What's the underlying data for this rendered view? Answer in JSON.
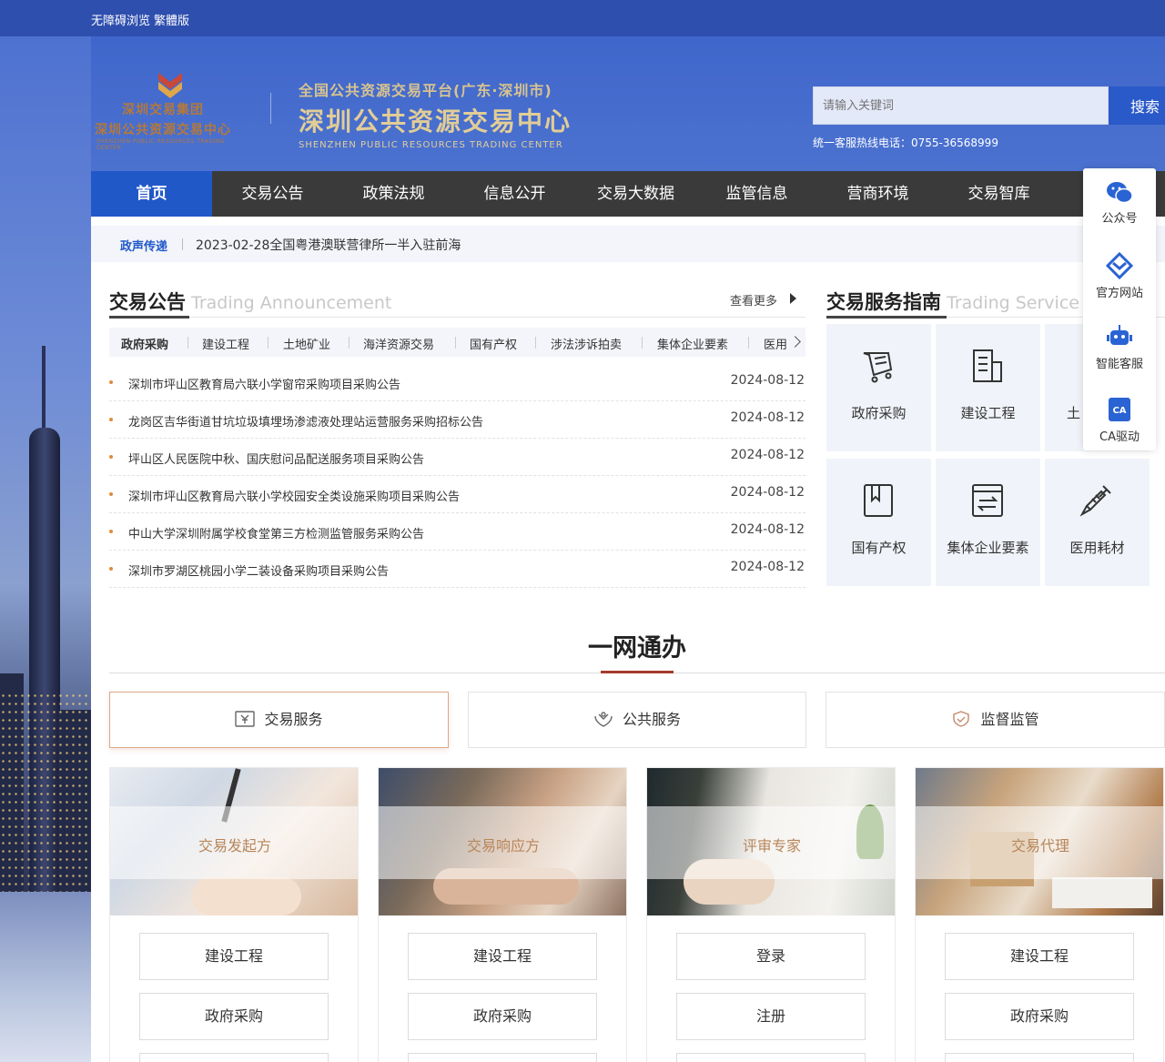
{
  "topbar": {
    "accessible": "无障碍浏览",
    "traditional": "繁體版"
  },
  "logo_group": {
    "line1": "深圳交易集团",
    "line2": "深圳公共资源交易中心",
    "line3": "SHENZHEN PUBLIC RESOURCES TRADING CENTER"
  },
  "logo_main": {
    "platform": "全国公共资源交易平台(广东·深圳市)",
    "name": "深圳公共资源交易中心",
    "english": "SHENZHEN PUBLIC RESOURCES TRADING CENTER"
  },
  "search": {
    "placeholder": "请输入关键词",
    "button": "搜索",
    "hotline": "统一客服热线电话：0755-36568999"
  },
  "nav": [
    "首页",
    "交易公告",
    "政策法规",
    "信息公开",
    "交易大数据",
    "监管信息",
    "营商环境",
    "交易智库"
  ],
  "ticker": {
    "label": "政声传递",
    "text": "2023-02-28全国粤港澳联营律所一半入驻前海"
  },
  "announcement": {
    "title": "交易公告",
    "title_en": "Trading Announcement",
    "more": "查看更多",
    "tabs": [
      "政府采购",
      "建设工程",
      "土地矿业",
      "海洋资源交易",
      "国有产权",
      "涉法涉诉拍卖",
      "集体企业要素",
      "医用"
    ],
    "items": [
      {
        "title": "深圳市坪山区教育局六联小学窗帘采购项目采购公告",
        "date": "2024-08-12"
      },
      {
        "title": "龙岗区吉华街道甘坑垃圾填埋场渗滤液处理站运营服务采购招标公告",
        "date": "2024-08-12"
      },
      {
        "title": "坪山区人民医院中秋、国庆慰问品配送服务项目采购公告",
        "date": "2024-08-12"
      },
      {
        "title": "深圳市坪山区教育局六联小学校园安全类设施采购项目采购公告",
        "date": "2024-08-12"
      },
      {
        "title": "中山大学深圳附属学校食堂第三方检测监管服务采购公告",
        "date": "2024-08-12"
      },
      {
        "title": "深圳市罗湖区桃园小学二装设备采购项目采购公告",
        "date": "2024-08-12"
      }
    ]
  },
  "service_guide": {
    "title": "交易服务指南",
    "title_en": "Trading Service",
    "cards": [
      "政府采购",
      "建设工程",
      "土",
      "国有产权",
      "集体企业要素",
      "医用耗材"
    ]
  },
  "float_bar": [
    "公众号",
    "官方网站",
    "智能客服",
    "CA驱动"
  ],
  "one_net": {
    "title": "一网通办",
    "tabs": [
      "交易服务",
      "公共服务",
      "监督监管"
    ],
    "columns": [
      {
        "caption": "交易发起方",
        "buttons": [
          "建设工程",
          "政府采购"
        ]
      },
      {
        "caption": "交易响应方",
        "buttons": [
          "建设工程",
          "政府采购"
        ]
      },
      {
        "caption": "评审专家",
        "buttons": [
          "登录",
          "注册"
        ]
      },
      {
        "caption": "交易代理",
        "buttons": [
          "建设工程",
          "政府采购"
        ]
      }
    ]
  },
  "colors": {
    "nav_active": "#2158c8",
    "nav_bg": "#3a3a3a",
    "accent_red": "#a33b2e",
    "gold": "#e2cd96"
  }
}
